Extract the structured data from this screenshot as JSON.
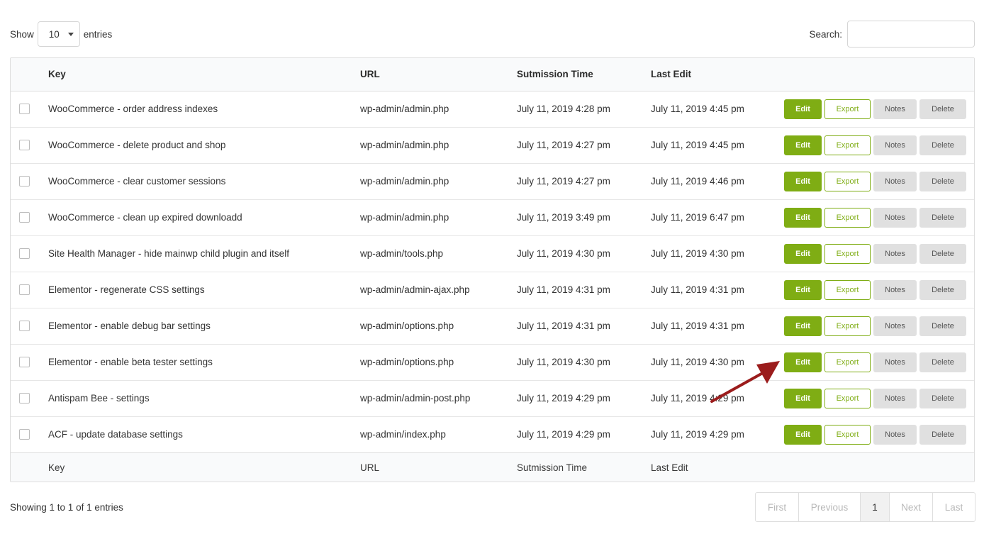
{
  "length_control": {
    "show_label": "Show",
    "value": "10",
    "entries_label": "entries"
  },
  "search": {
    "label": "Search:",
    "value": ""
  },
  "table": {
    "columns": [
      "Key",
      "URL",
      "Sutmission Time",
      "Last Edit"
    ],
    "rows": [
      {
        "key": "WooCommerce - order address indexes",
        "url": "wp-admin/admin.php",
        "submitted": "July 11, 2019 4:28 pm",
        "last_edit": "July 11, 2019 4:45 pm"
      },
      {
        "key": "WooCommerce - delete product and shop",
        "url": "wp-admin/admin.php",
        "submitted": "July 11, 2019 4:27 pm",
        "last_edit": "July 11, 2019 4:45 pm"
      },
      {
        "key": "WooCommerce - clear customer sessions",
        "url": "wp-admin/admin.php",
        "submitted": "July 11, 2019 4:27 pm",
        "last_edit": "July 11, 2019 4:46 pm"
      },
      {
        "key": "WooCommerce - clean up expired downloadd",
        "url": "wp-admin/admin.php",
        "submitted": "July 11, 2019 3:49 pm",
        "last_edit": "July 11, 2019 6:47 pm"
      },
      {
        "key": "Site Health Manager - hide mainwp child plugin and itself",
        "url": "wp-admin/tools.php",
        "submitted": "July 11, 2019 4:30 pm",
        "last_edit": "July 11, 2019 4:30 pm"
      },
      {
        "key": "Elementor - regenerate CSS settings",
        "url": "wp-admin/admin-ajax.php",
        "submitted": "July 11, 2019 4:31 pm",
        "last_edit": "July 11, 2019 4:31 pm"
      },
      {
        "key": "Elementor - enable debug bar settings",
        "url": "wp-admin/options.php",
        "submitted": "July 11, 2019 4:31 pm",
        "last_edit": "July 11, 2019 4:31 pm"
      },
      {
        "key": "Elementor - enable beta tester settings",
        "url": "wp-admin/options.php",
        "submitted": "July 11, 2019 4:30 pm",
        "last_edit": "July 11, 2019 4:30 pm"
      },
      {
        "key": "Antispam Bee - settings",
        "url": "wp-admin/admin-post.php",
        "submitted": "July 11, 2019 4:29 pm",
        "last_edit": "July 11, 2019 4:29 pm"
      },
      {
        "key": "ACF - update database settings",
        "url": "wp-admin/index.php",
        "submitted": "July 11, 2019 4:29 pm",
        "last_edit": "July 11, 2019 4:29 pm"
      }
    ],
    "actions": {
      "edit": "Edit",
      "export": "Export",
      "notes": "Notes",
      "delete": "Delete"
    }
  },
  "info": "Showing 1 to 1 of 1 entries",
  "pagination": {
    "first": "First",
    "previous": "Previous",
    "current": "1",
    "next": "Next",
    "last": "Last"
  },
  "colors": {
    "accent": "#7fad14",
    "annotation_arrow": "#9b1c1c",
    "neutral_button": "#e0e0e0"
  }
}
